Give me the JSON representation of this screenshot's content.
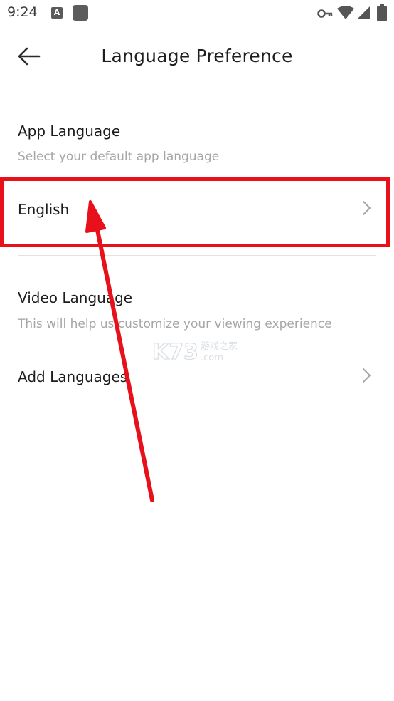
{
  "status_bar": {
    "time": "9:24",
    "icons": [
      "a-notification-icon",
      "app-square-icon",
      "vpn-key-icon",
      "wifi-icon",
      "cell-signal-icon",
      "battery-icon"
    ]
  },
  "toolbar": {
    "title": "Language Preference",
    "back_icon": "arrow-left-icon"
  },
  "app_language": {
    "title": "App Language",
    "subtitle": "Select your default app language",
    "selected": "English",
    "chevron_icon": "chevron-right-icon"
  },
  "video_language": {
    "title": "Video Language",
    "subtitle": "This will help us customize your viewing experience",
    "add_label": "Add Languages",
    "chevron_icon": "chevron-right-icon"
  },
  "annotation": {
    "color": "#e8101a"
  },
  "watermark": {
    "main": "K73",
    "cn": "游戏之家",
    "domain": ".com"
  },
  "colors": {
    "text_primary": "#1c1c1c",
    "text_secondary": "#a6a6a6",
    "divider": "#e2e2e2",
    "annotation": "#e8101a"
  }
}
